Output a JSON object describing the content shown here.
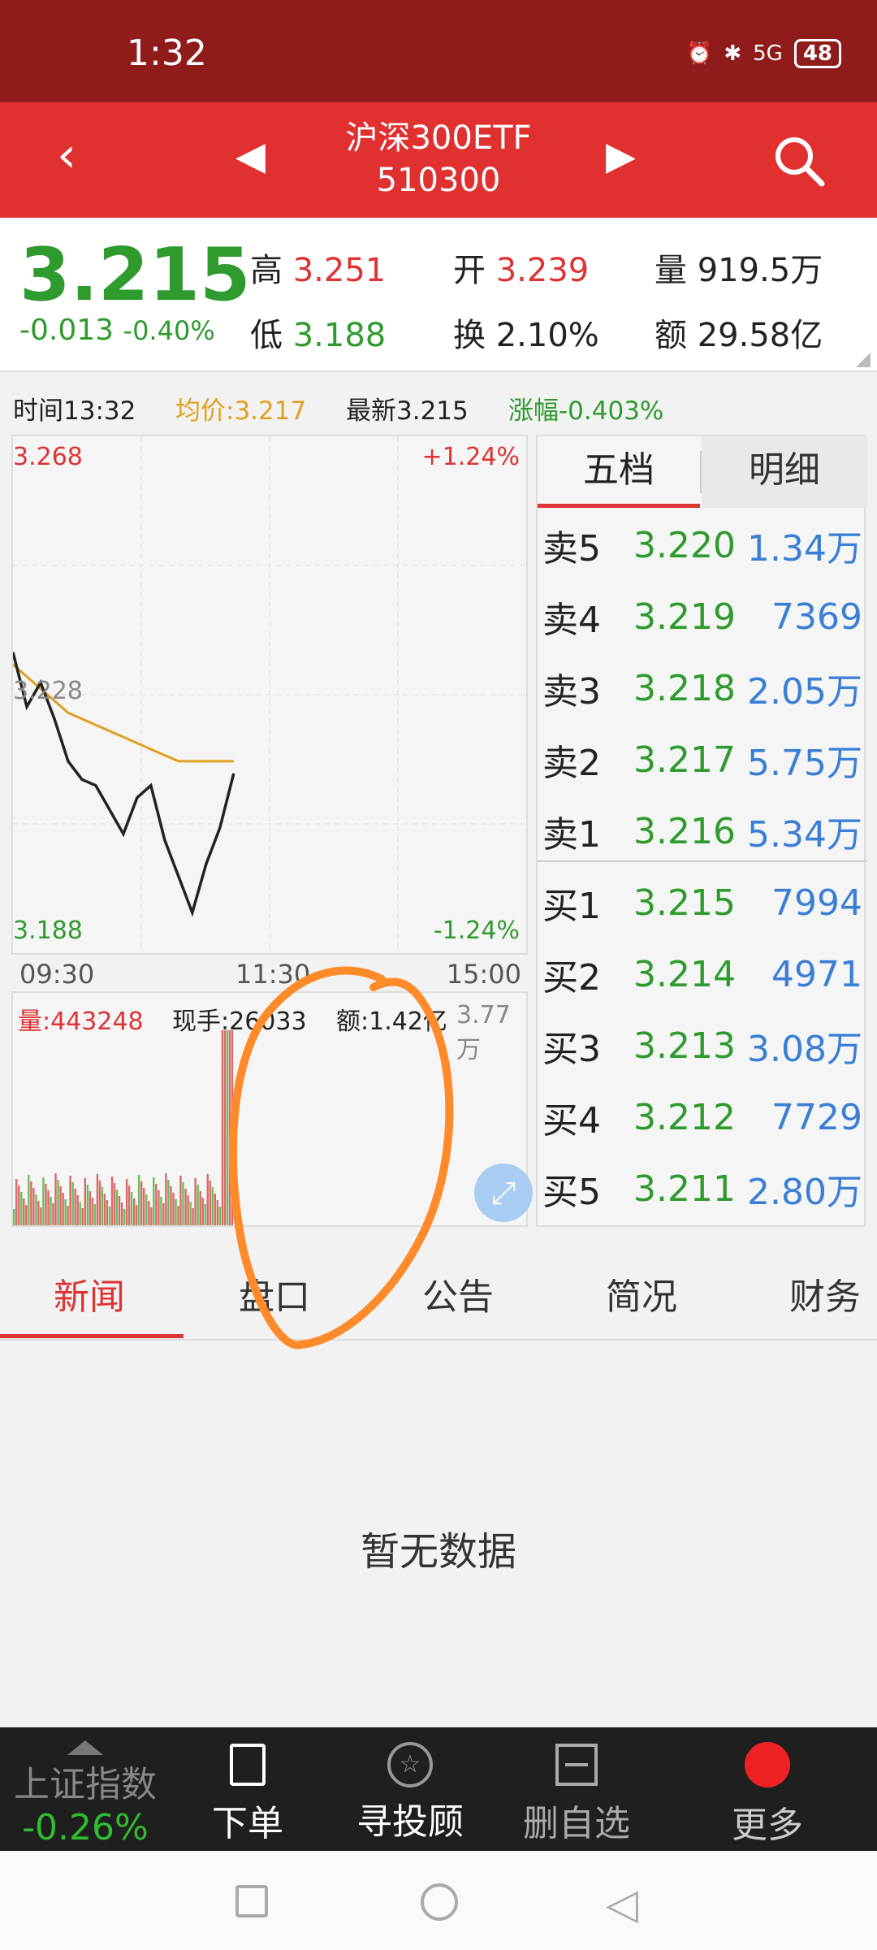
{
  "status": {
    "time": "1:32",
    "battery": "48",
    "signal_text": "5G"
  },
  "header": {
    "name": "沪深300ETF",
    "code": "510300"
  },
  "quote": {
    "price": "3.215",
    "change": "-0.013",
    "change_pct": "-0.40%",
    "high_label": "高",
    "high": "3.251",
    "low_label": "低",
    "low": "3.188",
    "open_label": "开",
    "open": "3.239",
    "turnover_label": "换",
    "turnover": "2.10%",
    "volume_label": "量",
    "volume": "919.5万",
    "amount_label": "额",
    "amount": "29.58亿"
  },
  "infobar": {
    "time": "时间13:32",
    "avg": "均价:3.217",
    "latest": "最新3.215",
    "chg": "涨幅-0.403%"
  },
  "chart_axis": {
    "top_price": "3.268",
    "mid_price": "3.228",
    "bottom_price": "3.188",
    "top_pct": "+1.24%",
    "bottom_pct": "-1.24%"
  },
  "time_axis": [
    "09:30",
    "11:30",
    "15:00"
  ],
  "volume_bar": {
    "vol": "量:443248",
    "hand": "现手:26033",
    "amount": "额:1.42亿",
    "max": "3.77万"
  },
  "panel_tabs": [
    "五档",
    "明细"
  ],
  "orderbook": [
    {
      "label": "卖5",
      "price": "3.220",
      "vol": "1.34万"
    },
    {
      "label": "卖4",
      "price": "3.219",
      "vol": "7369"
    },
    {
      "label": "卖3",
      "price": "3.218",
      "vol": "2.05万"
    },
    {
      "label": "卖2",
      "price": "3.217",
      "vol": "5.75万"
    },
    {
      "label": "卖1",
      "price": "3.216",
      "vol": "5.34万"
    },
    {
      "label": "买1",
      "price": "3.215",
      "vol": "7994"
    },
    {
      "label": "买2",
      "price": "3.214",
      "vol": "4971"
    },
    {
      "label": "买3",
      "price": "3.213",
      "vol": "3.08万"
    },
    {
      "label": "买4",
      "price": "3.212",
      "vol": "7729"
    },
    {
      "label": "买5",
      "price": "3.211",
      "vol": "2.80万"
    }
  ],
  "tabs": [
    "新闻",
    "盘口",
    "公告",
    "简况",
    "财务"
  ],
  "empty_text": "暂无数据",
  "bottom_nav": {
    "index_name": "上证指数",
    "index_change": "-0.26%",
    "order": "下单",
    "advisor": "寻投顾",
    "remove": "删自选",
    "more": "更多"
  },
  "colors": {
    "up": "#d33",
    "down": "#2f9b2f",
    "header": "#e03030",
    "statusbar": "#8f1b1b",
    "avg_line": "#e0a020",
    "annotation": "#ff8a2a"
  },
  "chart_data": {
    "type": "line",
    "ylim": [
      3.188,
      3.268
    ],
    "x": [
      "09:30",
      "11:30",
      "15:00"
    ],
    "series": [
      {
        "values": [
          3.235,
          3.226,
          3.23,
          3.224,
          3.217,
          3.214,
          3.213,
          3.209,
          3.205,
          3.211,
          3.213,
          3.204,
          3.198,
          3.192,
          3.2,
          3.206,
          3.215
        ]
      },
      {
        "values": [
          3.233,
          3.231,
          3.229,
          3.227,
          3.225,
          3.224,
          3.223,
          3.222,
          3.221,
          3.22,
          3.219,
          3.218,
          3.217,
          3.217,
          3.217,
          3.217,
          3.217
        ]
      }
    ]
  }
}
